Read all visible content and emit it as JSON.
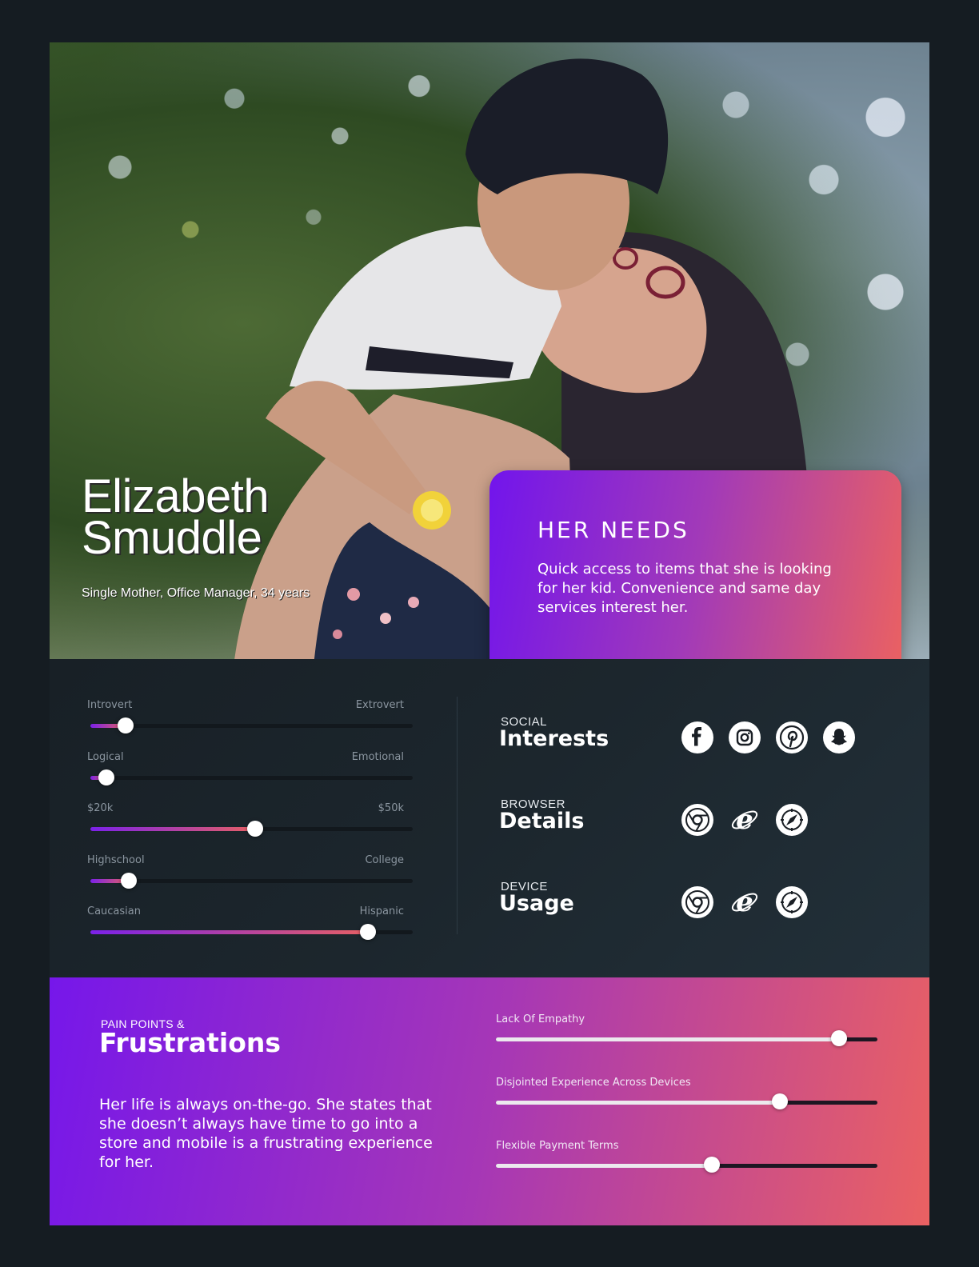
{
  "persona": {
    "first_name": "Elizabeth",
    "last_name": "Smuddle",
    "subtitle": "Single Mother, Office Manager, 34 years"
  },
  "needs": {
    "title": "HER NEEDS",
    "body": "Quick access to items that she is looking for her kid. Convenience and same day services interest her."
  },
  "traits": [
    {
      "left": "Introvert",
      "right": "Extrovert",
      "value": 0.11
    },
    {
      "left": "Logical",
      "right": "Emotional",
      "value": 0.05
    },
    {
      "left": "$20k",
      "right": "$50k",
      "value": 0.51
    },
    {
      "left": "Highschool",
      "right": "College",
      "value": 0.12
    },
    {
      "left": "Caucasian",
      "right": "Hispanic",
      "value": 0.86
    }
  ],
  "groups": [
    {
      "kicker": "SOCIAL",
      "title": "Interests",
      "icons": [
        "facebook-icon",
        "instagram-icon",
        "pinterest-icon",
        "snapchat-icon"
      ]
    },
    {
      "kicker": "BROWSER",
      "title": "Details",
      "icons": [
        "chrome-icon",
        "internet-explorer-icon",
        "safari-icon"
      ]
    },
    {
      "kicker": "DEVICE",
      "title": "Usage",
      "icons": [
        "chrome-icon",
        "internet-explorer-icon",
        "safari-icon"
      ]
    }
  ],
  "pain": {
    "kicker": "PAIN POINTS &",
    "title": "Frustrations",
    "body": "Her life is always on-the-go. She states that she doesn’t always have time to go into a store and mobile is a frustrating experience for her.",
    "bars": [
      {
        "label": "Lack Of Empathy",
        "value": 0.9
      },
      {
        "label": "Disjointed Experience Across Devices",
        "value": 0.745
      },
      {
        "label": "Flexible Payment Terms",
        "value": 0.567
      }
    ]
  },
  "colors": {
    "background": "#151c22",
    "gradient_start": "#7215ec",
    "gradient_end": "#ea6162",
    "panel": "#1c262d"
  }
}
